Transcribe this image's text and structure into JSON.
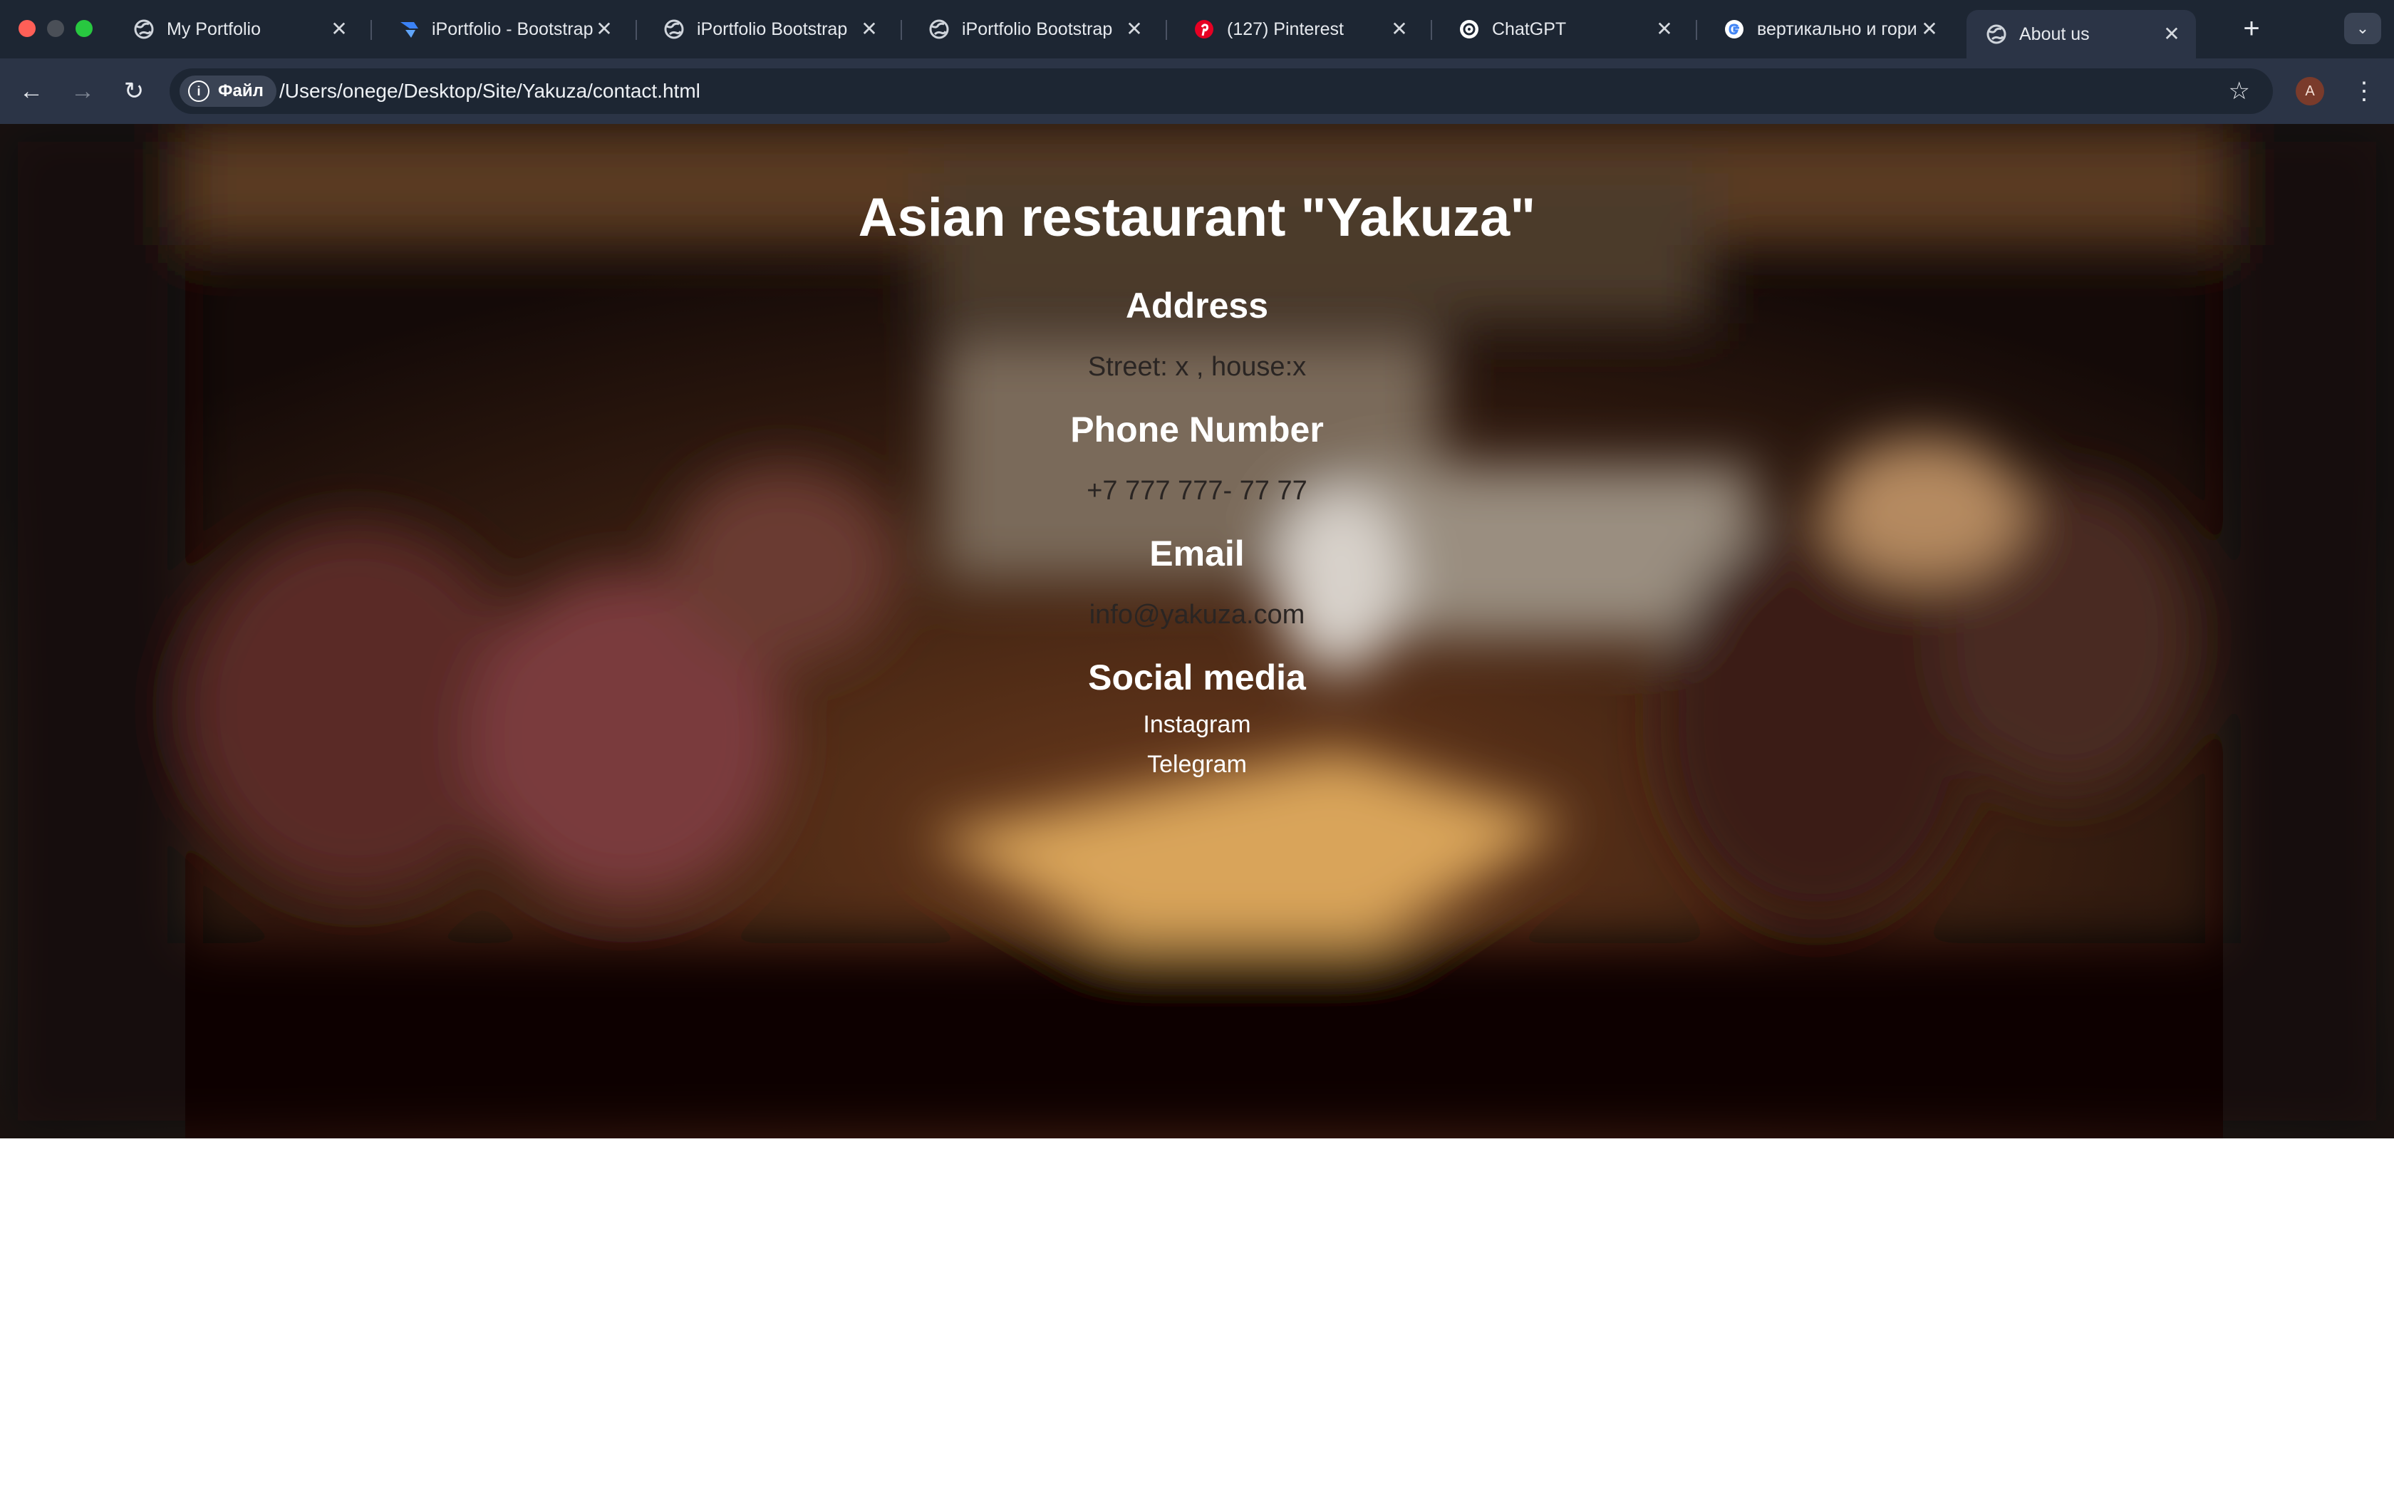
{
  "browser": {
    "tabs": [
      {
        "title": "My Portfolio",
        "icon": "globe-icon"
      },
      {
        "title": "iPortfolio - Bootstrap",
        "icon": "bootstrapmade-icon"
      },
      {
        "title": "iPortfolio Bootstrap",
        "icon": "globe-icon"
      },
      {
        "title": "iPortfolio Bootstrap",
        "icon": "globe-icon"
      },
      {
        "title": "(127) Pinterest",
        "icon": "pinterest-icon"
      },
      {
        "title": "ChatGPT",
        "icon": "chatgpt-icon"
      },
      {
        "title": "вертикально и гори",
        "icon": "google-icon"
      },
      {
        "title": "About us",
        "icon": "globe-icon"
      }
    ],
    "active_tab_index": 7,
    "new_tab_label": "+",
    "address_chip_label": "Файл",
    "url": "/Users/onege/Desktop/Site/Yakuza/contact.html",
    "profile_initial": "A"
  },
  "page": {
    "title": "Asian restaurant \"Yakuza\"",
    "address_heading": "Address",
    "address_value": "Street: x , house:x",
    "phone_heading": "Phone Number",
    "phone_value": "+7 777 777- 77 77",
    "email_heading": "Email",
    "email_value": "info@yakuza.com",
    "social_heading": "Social media",
    "social_links": [
      "Instagram",
      "Telegram"
    ]
  },
  "colors": {
    "tab_strip": "#1d2633",
    "toolbar": "#2b3446",
    "omnibox": "#1d2633",
    "page_text_dark": "#2a2523"
  }
}
